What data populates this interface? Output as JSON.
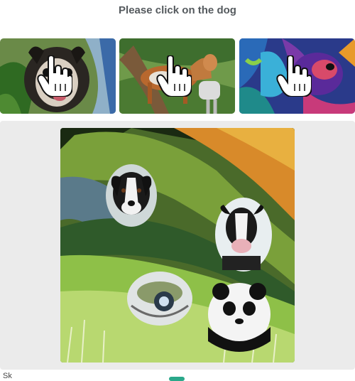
{
  "prompt": {
    "text": "Please click on the dog"
  },
  "thumbnails": [
    {
      "subject": "pug watercolor",
      "icon": "pointer-hand-icon"
    },
    {
      "subject": "dog walking watercolor",
      "icon": "pointer-hand-icon"
    },
    {
      "subject": "colorful dog watercolor",
      "icon": "pointer-hand-icon"
    }
  ],
  "main_image": {
    "subjects": [
      "dog",
      "cow",
      "turtle",
      "panda"
    ]
  },
  "footer": {
    "text": "Sk"
  },
  "colors": {
    "panel": "#ebebeb",
    "prompt_text": "#555a5e",
    "accent": "#2aa88a"
  }
}
